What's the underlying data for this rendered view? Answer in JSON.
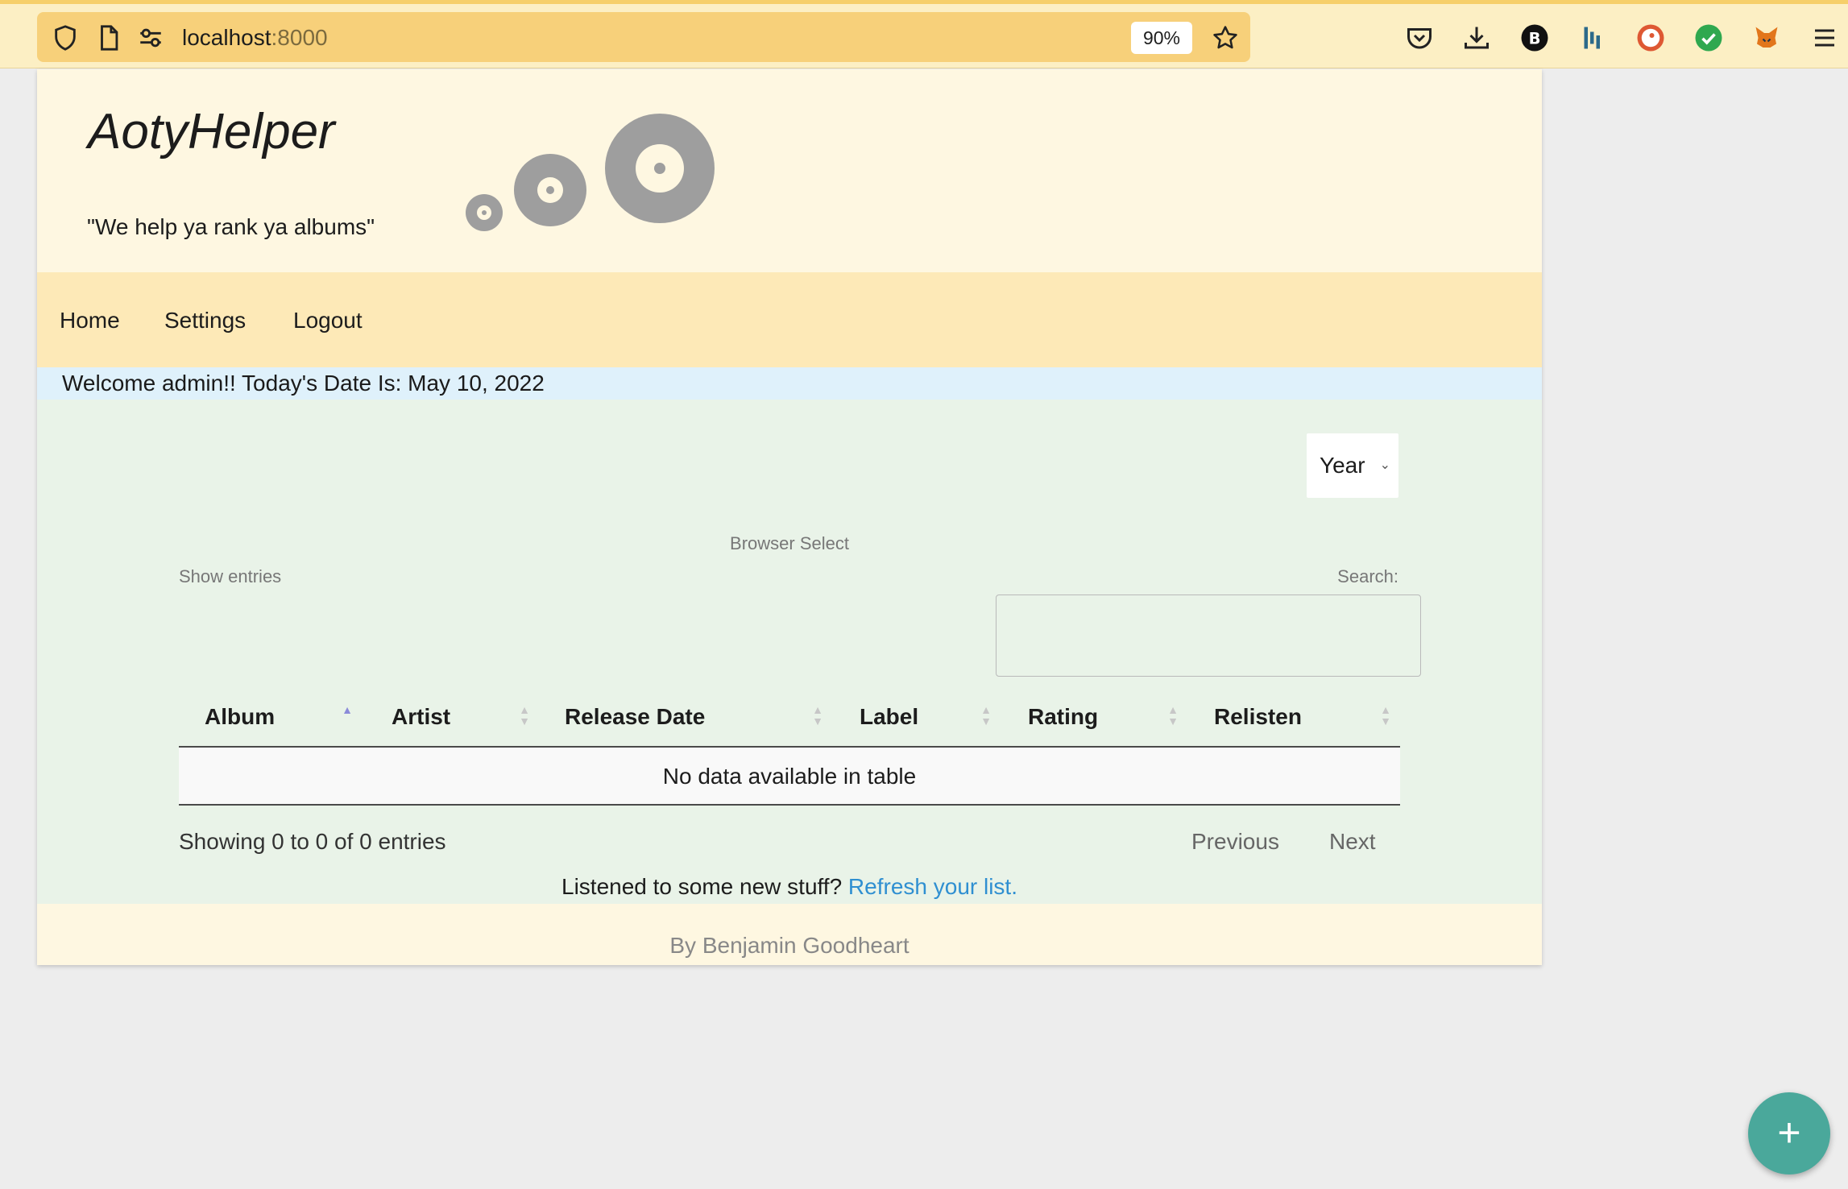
{
  "browser": {
    "url_host": "localhost",
    "url_port": ":8000",
    "zoom": "90%",
    "icons": [
      "shield-icon",
      "page-icon",
      "permissions-icon",
      "bookmark-star-icon",
      "pocket-icon",
      "download-icon",
      "extension-b-icon",
      "extension-bars-icon",
      "duckduckgo-icon",
      "check-icon",
      "metamask-icon",
      "menu-icon"
    ]
  },
  "header": {
    "title": "AotyHelper",
    "tagline": "\"We help ya rank ya albums\""
  },
  "nav": {
    "items": [
      {
        "label": "Home"
      },
      {
        "label": "Settings"
      },
      {
        "label": "Logout"
      }
    ]
  },
  "welcome": "Welcome admin!! Today's Date Is: May 10, 2022",
  "filters": {
    "year_select": "Year",
    "browser_select": "Browser Select"
  },
  "table_controls": {
    "show_entries": "Show entries",
    "search_label": "Search:",
    "search_value": ""
  },
  "table": {
    "columns": [
      "Album",
      "Artist",
      "Release Date",
      "Label",
      "Rating",
      "Relisten"
    ],
    "sorted_column": "Album",
    "sort_direction": "ascending",
    "empty_message": "No data available in table"
  },
  "pagination": {
    "info": "Showing 0 to 0 of 0 entries",
    "previous": "Previous",
    "next": "Next"
  },
  "refresh": {
    "prompt": "Listened to some new stuff? ",
    "link": "Refresh your list."
  },
  "footer": "By Benjamin Goodheart",
  "fab": "+",
  "colors": {
    "toolbar": "#fcefc4",
    "urlbar": "#f7d07a",
    "header_bg": "#fef7e1",
    "nav_bg": "#fde9b7",
    "welcome_bg": "#dff1fb",
    "main_bg": "#e9f3e8",
    "link": "#2f8fd1",
    "fab": "#4aa89b"
  }
}
